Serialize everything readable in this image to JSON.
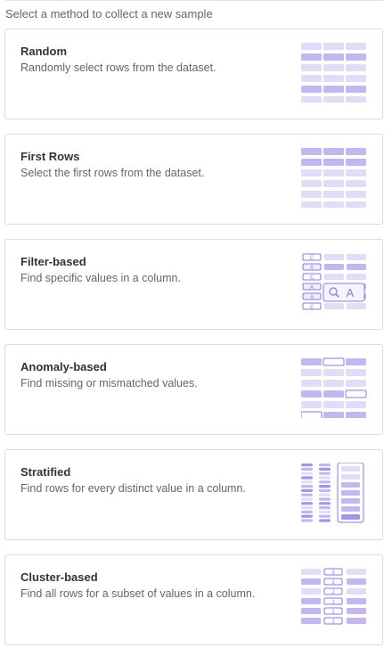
{
  "heading": "Select a method to collect a new sample",
  "colors": {
    "cell_light": "#e3dcf6",
    "cell_mid": "#c4b6ee",
    "cell_dark": "#a795e3",
    "accent": "#8f77db",
    "border": "#dcdcdc"
  },
  "methods": [
    {
      "id": "random",
      "title": "Random",
      "description": "Randomly select rows from the dataset.",
      "icon": "random-sample-icon"
    },
    {
      "id": "first-rows",
      "title": "First Rows",
      "description": "Select the first rows from the dataset.",
      "icon": "first-rows-icon"
    },
    {
      "id": "filter-based",
      "title": "Filter-based",
      "description": "Find specific values in a column.",
      "icon": "filter-search-icon",
      "icon_labels": {
        "cells": [
          "C",
          "A",
          "C",
          "A",
          "A",
          "C"
        ],
        "search": "A"
      }
    },
    {
      "id": "anomaly-based",
      "title": "Anomaly-based",
      "description": "Find missing or mismatched values.",
      "icon": "anomaly-icon"
    },
    {
      "id": "stratified",
      "title": "Stratified",
      "description": "Find rows for every distinct value in a column.",
      "icon": "stratified-icon"
    },
    {
      "id": "cluster-based",
      "title": "Cluster-based",
      "description": "Find all rows for a subset of values in a column.",
      "icon": "cluster-icon",
      "icon_labels": {
        "cells": [
          "3",
          "2",
          "2",
          "1",
          "1",
          "1"
        ]
      }
    }
  ]
}
